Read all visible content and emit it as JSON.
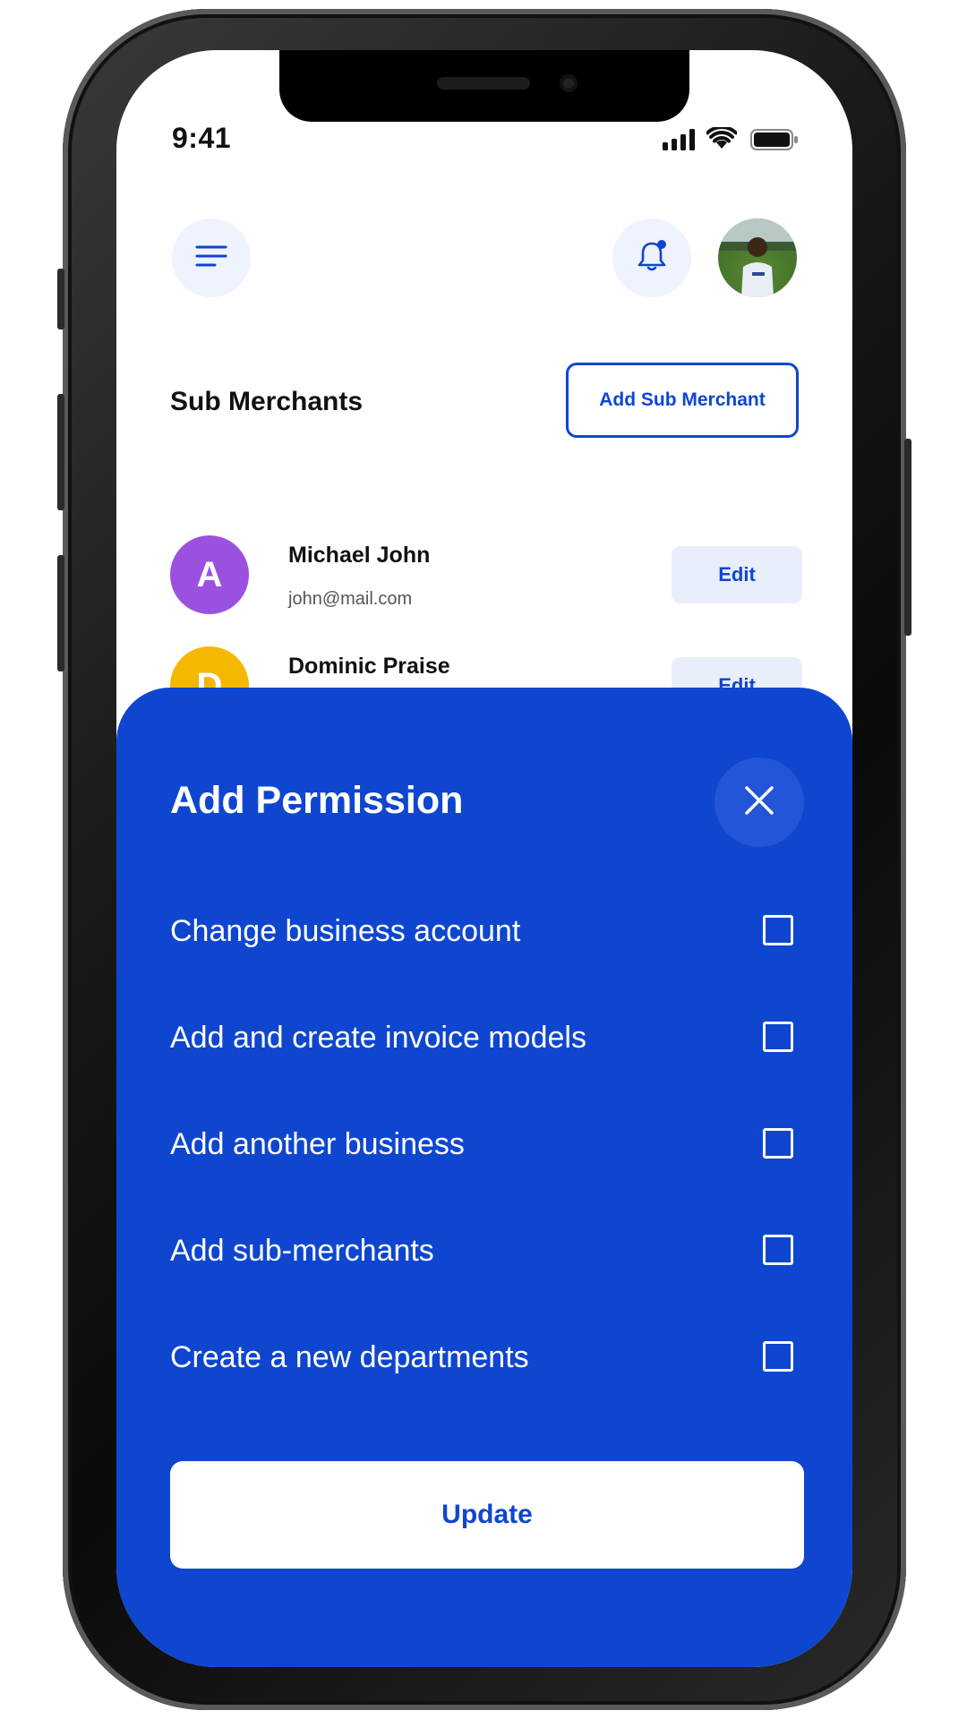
{
  "status_bar": {
    "time": "9:41"
  },
  "header": {
    "menu_icon": "menu-icon",
    "bell_icon": "bell-icon"
  },
  "section": {
    "title": "Sub Merchants",
    "add_button": "Add Sub Merchant"
  },
  "merchants": [
    {
      "initial": "A",
      "name": "Michael John",
      "email": "john@mail.com",
      "edit_label": "Edit",
      "color": "#9b51e0"
    },
    {
      "initial": "D",
      "name": "Dominic Praise",
      "edit_label": "Edit",
      "color": "#f5b800"
    }
  ],
  "sheet": {
    "title": "Add Permission",
    "close_icon": "close-icon",
    "permissions": [
      {
        "label": "Change business account",
        "checked": false
      },
      {
        "label": "Add and create invoice models",
        "checked": false
      },
      {
        "label": "Add another business",
        "checked": false
      },
      {
        "label": "Add sub-merchants",
        "checked": false
      },
      {
        "label": "Create a new departments",
        "checked": false
      }
    ],
    "update_label": "Update"
  },
  "colors": {
    "accent": "#0f46d0",
    "sheet_bg": "#0f46d0",
    "light_btn": "#e8eefb"
  }
}
